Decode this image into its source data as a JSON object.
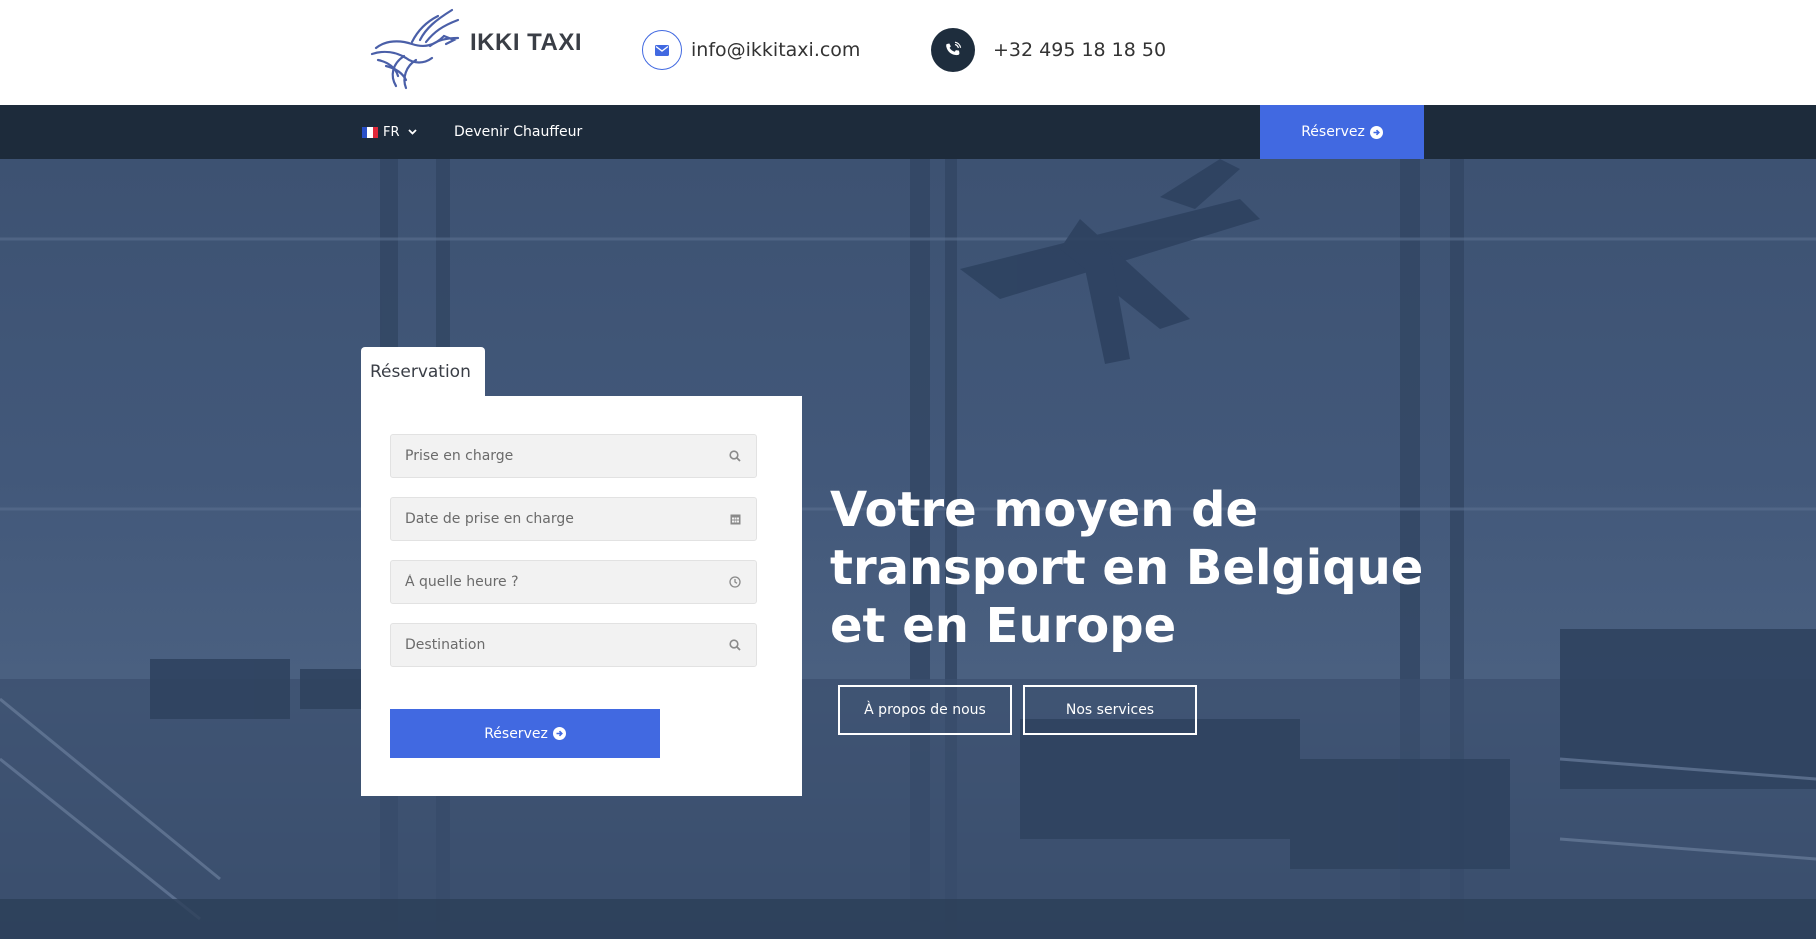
{
  "brand": {
    "name": "IKKI TAXI"
  },
  "contact": {
    "email": "info@ikkitaxi.com",
    "phone": "+32 495 18 18 50"
  },
  "nav": {
    "language": "FR",
    "link": "Devenir Chauffeur",
    "cta": "Réservez"
  },
  "reservation": {
    "tab_label": "Réservation",
    "fields": [
      {
        "placeholder": "Prise en charge",
        "icon": "search-icon"
      },
      {
        "placeholder": "Date de prise en charge",
        "icon": "calendar-icon"
      },
      {
        "placeholder": "À quelle heure ?",
        "icon": "clock-icon"
      },
      {
        "placeholder": "Destination",
        "icon": "search-icon"
      }
    ],
    "submit": "Réservez"
  },
  "hero": {
    "title": "Votre moyen de transport en Belgique et en Europe",
    "buttons": {
      "about": "À propos de nous",
      "services": "Nos services"
    }
  },
  "colors": {
    "accent": "#4169e1",
    "navbar": "#1d2b3b",
    "hero_tint": "#42587a"
  }
}
